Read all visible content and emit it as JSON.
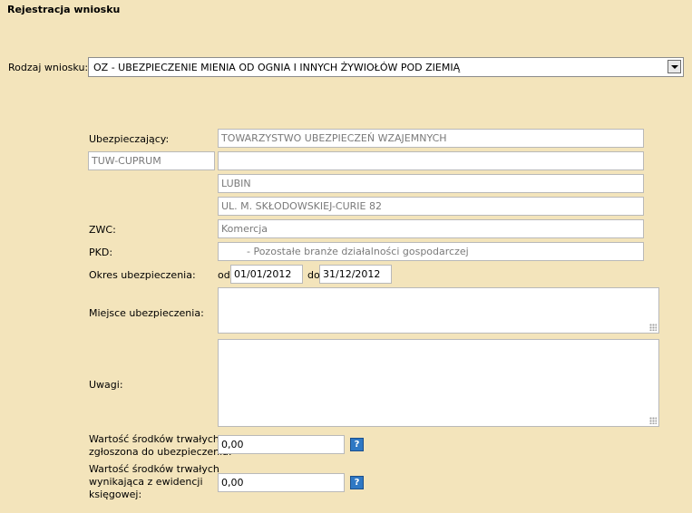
{
  "page": {
    "title": "Rejestracja wniosku"
  },
  "form": {
    "rodzaj_label": "Rodzaj wniosku:",
    "rodzaj_value": "OZ - UBEZPIECZENIE MIENIA OD OGNIA I INNYCH ŻYWIOŁÓW POD ZIEMIĄ",
    "ubezpieczajacy_label": "Ubezpieczający:",
    "ubezpieczajacy_name": "TOWARZYSTWO UBEZPIECZEŃ WZAJEMNYCH",
    "ubezpieczajacy_short": "TUW-CUPRUM",
    "ubezpieczajacy_line2": "",
    "ubezpieczajacy_city": "LUBIN",
    "ubezpieczajacy_street": "UL. M. SKŁODOWSKIEJ-CURIE 82",
    "zwc_label": "ZWC:",
    "zwc_value": "Komercja",
    "pkd_label": "PKD:",
    "pkd_value": "- Pozostałe branże działalności gospodarczej",
    "okres_label": "Okres ubezpieczenia:",
    "od_label": "od",
    "od_value": "01/01/2012",
    "do_label": "do",
    "do_value": "31/12/2012",
    "miejsce_label": "Miejsce ubezpieczenia:",
    "miejsce_value": "",
    "uwagi_label": "Uwagi:",
    "uwagi_value": "",
    "wartosc1_label_line1": "Wartość środków trwałych",
    "wartosc1_label_line2": "zgłoszona do ubezpieczenia:",
    "wartosc1_value": "0,00",
    "wartosc2_label_line1": "Wartość środków trwałych",
    "wartosc2_label_line2": "wynikająca z ewidencji",
    "wartosc2_label_line3": "księgowej:",
    "wartosc2_value": "0,00",
    "help_glyph": "?"
  },
  "icons": {
    "dropdown": "chevron-down-icon",
    "help": "help-icon",
    "resize": "resize-grip-icon"
  },
  "colors": {
    "background": "#f3e4bb",
    "help_button": "#2f78c4"
  }
}
